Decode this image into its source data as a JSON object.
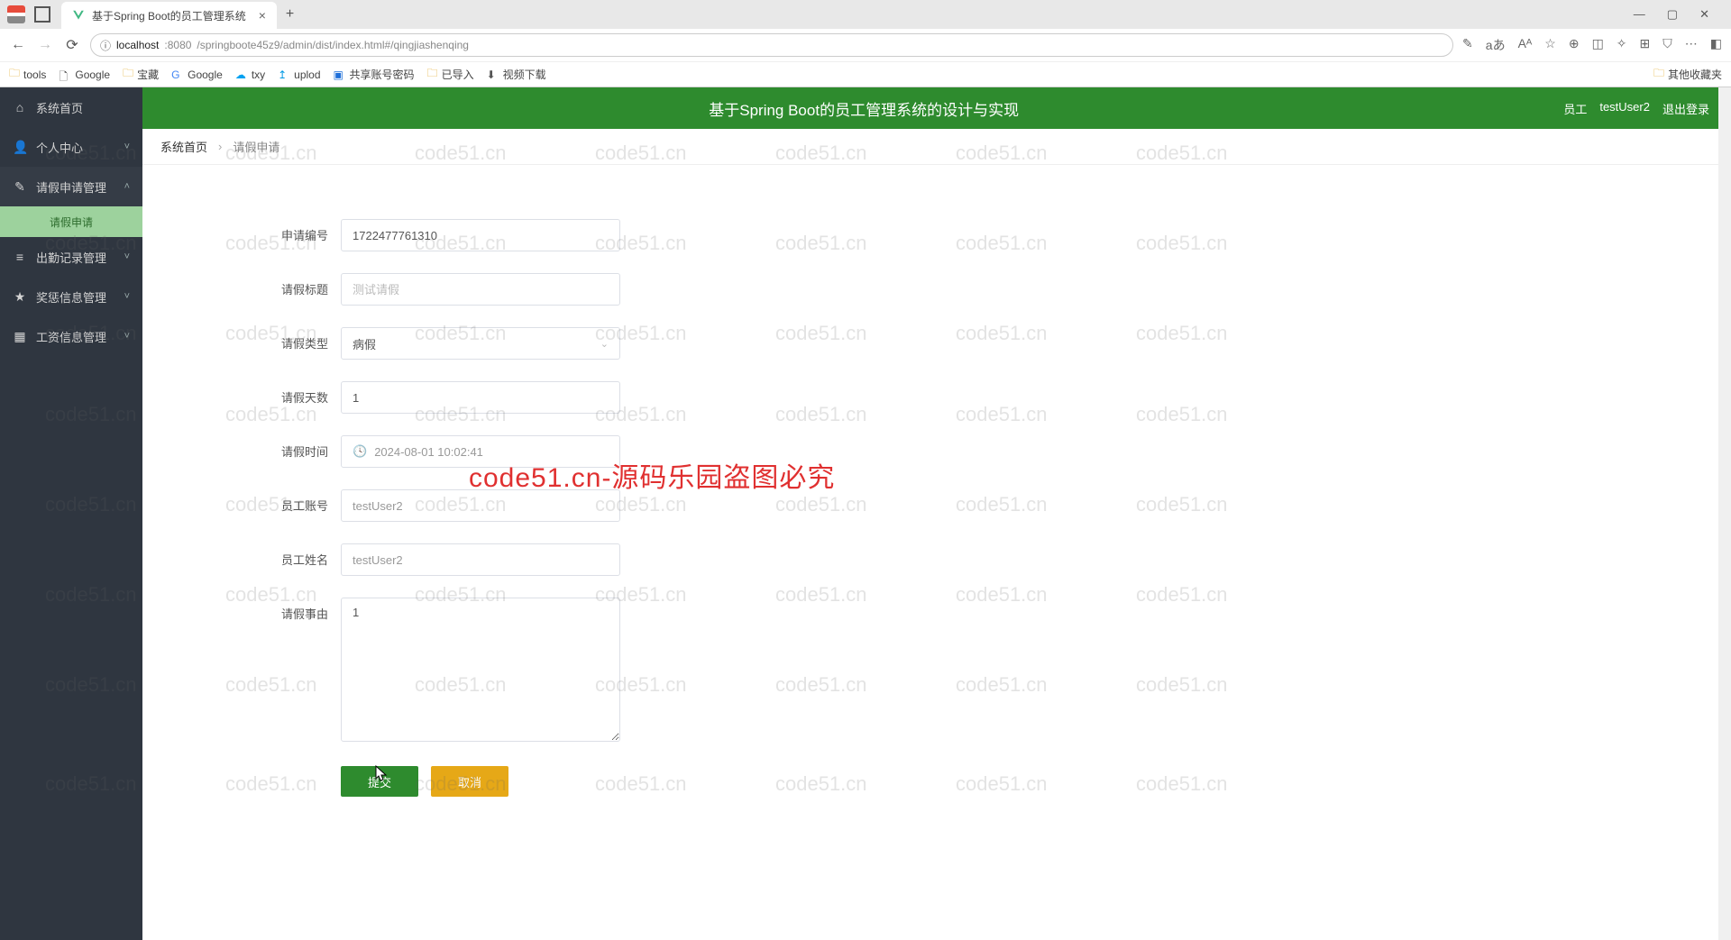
{
  "browser": {
    "tab_title": "基于Spring Boot的员工管理系统",
    "url_host": "localhost",
    "url_port": ":8080",
    "url_path": "/springboote45z9/admin/dist/index.html#/qingjiashenqing",
    "bookmarks": [
      "tools",
      "Google",
      "宝藏",
      "Google",
      "txy",
      "uplod",
      "共享账号密码",
      "已导入",
      "视频下载"
    ],
    "bookmark_right": "其他收藏夹"
  },
  "header": {
    "title": "基于Spring Boot的员工管理系统的设计与实现",
    "role": "员工",
    "user": "testUser2",
    "logout": "退出登录"
  },
  "crumbs": {
    "home": "系统首页",
    "current": "请假申请"
  },
  "sidebar": {
    "items": [
      {
        "icon": "⌂",
        "label": "系统首页"
      },
      {
        "icon": "👤",
        "label": "个人中心",
        "chev": "˅"
      },
      {
        "icon": "✎",
        "label": "请假申请管理",
        "chev": "˄"
      },
      {
        "icon": "≡",
        "label": "出勤记录管理",
        "chev": "˅"
      },
      {
        "icon": "★",
        "label": "奖惩信息管理",
        "chev": "˅"
      },
      {
        "icon": "▦",
        "label": "工资信息管理",
        "chev": "˅"
      }
    ],
    "sub": "请假申请"
  },
  "form": {
    "labels": {
      "req_no": "申请编号",
      "title": "请假标题",
      "type": "请假类型",
      "days": "请假天数",
      "time": "请假时间",
      "account": "员工账号",
      "name": "员工姓名",
      "reason": "请假事由"
    },
    "values": {
      "req_no": "1722477761310",
      "title_ph": "测试请假",
      "type": "病假",
      "days": "1",
      "time": "2024-08-01 10:02:41",
      "account": "testUser2",
      "name": "testUser2",
      "reason": "1"
    },
    "submit": "提交",
    "cancel": "取消"
  },
  "watermark": {
    "text": "code51.cn",
    "main": "code51.cn-源码乐园盗图必究"
  }
}
